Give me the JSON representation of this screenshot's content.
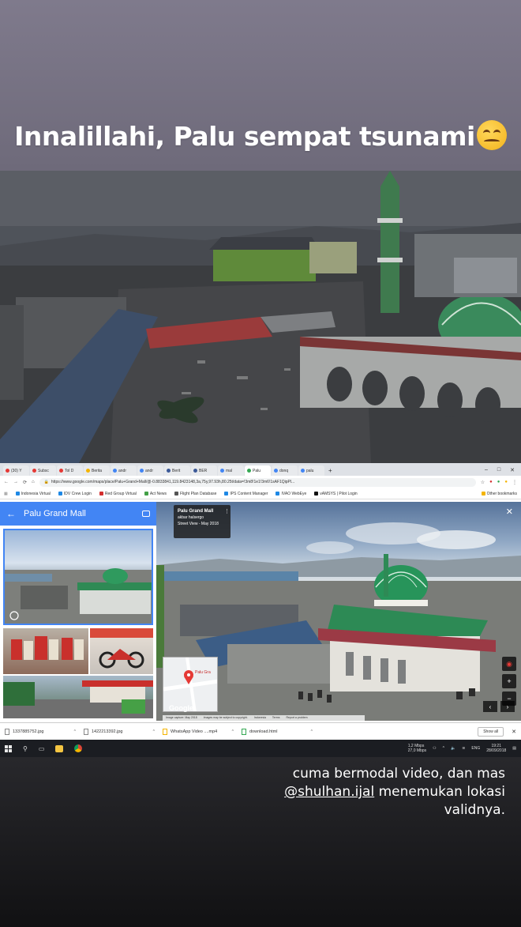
{
  "story": {
    "title": "Innalillahi, Palu sempat tsunami",
    "emoji": "confounded-face-emoji",
    "caption_line1": "cuma bermodal video, dan mas",
    "caption_mention": "@shulhan.ijal",
    "caption_line2": " menemukan lokasi validnya."
  },
  "browser": {
    "tabs": [
      {
        "label": "(30) Y",
        "color": "#e53935"
      },
      {
        "label": "Subsc",
        "color": "#e53935"
      },
      {
        "label": "Tol D",
        "color": "#e53935"
      },
      {
        "label": "Berita",
        "color": "#f4b400"
      },
      {
        "label": "andr",
        "color": "#4285f4"
      },
      {
        "label": "andr",
        "color": "#4285f4"
      },
      {
        "label": "Berit",
        "color": "#3b5998"
      },
      {
        "label": "BER",
        "color": "#3b5998"
      },
      {
        "label": "mal",
        "color": "#4285f4"
      },
      {
        "label": "Palu",
        "color": "#34a853",
        "active": true
      },
      {
        "label": "donq",
        "color": "#4285f4"
      },
      {
        "label": "palu",
        "color": "#4285f4"
      }
    ],
    "url": "https://www.google.com/maps/place/Palu+Grand+Mall/@-0.8833841,119.8423148,3a,75y,97.93h,80.25t/data=!3m8!1e1!3m6!1sAF1QipPl...",
    "bookmarks": [
      {
        "label": "Indonesia Virtual",
        "color": "#1e88e5"
      },
      {
        "label": "IDV Crew Login",
        "color": "#1e88e5"
      },
      {
        "label": "Red Group Virtual",
        "color": "#d32f2f"
      },
      {
        "label": "Act News",
        "color": "#43a047"
      },
      {
        "label": "Flight Plan Database",
        "color": "#555555"
      },
      {
        "label": "IPS Content Manager",
        "color": "#1e88e5"
      },
      {
        "label": "IVAO WebEye",
        "color": "#1e88e5"
      },
      {
        "label": "vAMSYS | Pilot Login",
        "color": "#111111"
      }
    ],
    "other_bookmarks": "Other bookmarks"
  },
  "maps": {
    "place_name": "Palu Grand Mall",
    "card_title": "Palu Grand Mall",
    "card_author": "akbar halsergo",
    "card_date": "Street View - May 2018",
    "minimap_label": "Palu Gra",
    "google": "Google",
    "footer": [
      "Image capture: May 2018",
      "Images may be subject to copyright.",
      "Indonesia",
      "Terms",
      "Report a problem"
    ]
  },
  "downloads": {
    "files": [
      "1337885752.jpg",
      "1422213392.jpg",
      "WhatsApp Video ....mp4",
      "download.html"
    ],
    "show_all": "Show all"
  },
  "taskbar": {
    "net_up": "1,2 Mbps",
    "net_down": "27,0 Mbps",
    "lang": "ENG",
    "time": "19:21",
    "date": "28/09/2018"
  }
}
